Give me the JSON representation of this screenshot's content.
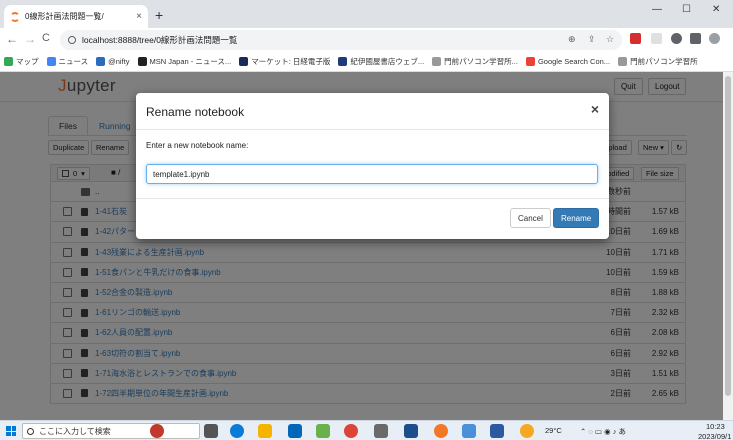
{
  "browser": {
    "tab_title": "0線形計画法問題一覧/",
    "tab_close": "×",
    "new_tab": "+",
    "window_controls": [
      "—",
      "☐",
      "✕"
    ],
    "nav": {
      "back": "←",
      "forward": "→",
      "reload": "C"
    },
    "url": "localhost:8888/tree/0線形計画法問題一覧",
    "bookmarks": [
      {
        "label": "マップ",
        "icon": "maps-icon",
        "color": "#34a853"
      },
      {
        "label": "ニュース",
        "icon": "news-icon",
        "color": "#4285f4"
      },
      {
        "label": "@nifty",
        "icon": "nifty-icon",
        "color": "#2a6ebb"
      },
      {
        "label": "MSN Japan - ニュース...",
        "icon": "msn-icon",
        "color": "#222222"
      },
      {
        "label": "マーケット: 日経電子版",
        "icon": "nikkei-icon",
        "color": "#1a2a5a"
      },
      {
        "label": "紀伊國屋書店ウェブ...",
        "icon": "kinokuniya-icon",
        "color": "#1f3b7a"
      },
      {
        "label": "門前パソコン学習所...",
        "icon": "globe-icon",
        "color": "#999999"
      },
      {
        "label": "Google Search Con...",
        "icon": "google-icon",
        "color": "#ea4335"
      },
      {
        "label": "門前パソコン学習所",
        "icon": "globe-icon",
        "color": "#999999"
      }
    ]
  },
  "jupyter": {
    "logo_text": "upyter",
    "logo_j": "J",
    "quit_label": "Quit",
    "logout_label": "Logout",
    "tabs": [
      "Files",
      "Running"
    ],
    "actions": {
      "duplicate": "Duplicate",
      "rename": "Rename",
      "upload": "Upload",
      "new": "New ▾",
      "refresh": "↻"
    },
    "list_header": {
      "select_count": "0",
      "dropdown": "▾",
      "folder": "/",
      "modified": "Modified",
      "filesize": "File size"
    },
    "files": [
      {
        "name": "..",
        "modified": "数秒前",
        "size": ""
      },
      {
        "name": "1-41石炭",
        "modified": "3時間前",
        "size": "1.57 kB"
      },
      {
        "name": "1-42パター",
        "modified": "10日前",
        "size": "1.69 kB"
      },
      {
        "name": "1-43残業による生産計画.ipynb",
        "modified": "10日前",
        "size": "1.71 kB"
      },
      {
        "name": "1-51食パンと牛乳だけの食事.ipynb",
        "modified": "10日前",
        "size": "1.59 kB"
      },
      {
        "name": "1-52合金の製造.ipynb",
        "modified": "8日前",
        "size": "1.88 kB"
      },
      {
        "name": "1-61リンゴの輸送.ipynb",
        "modified": "7日前",
        "size": "2.32 kB"
      },
      {
        "name": "1-62人員の配置.ipynb",
        "modified": "6日前",
        "size": "2.08 kB"
      },
      {
        "name": "1-63切符の割当て.ipynb",
        "modified": "6日前",
        "size": "2.92 kB"
      },
      {
        "name": "1-71海水浴とレストランでの食事.ipynb",
        "modified": "3日前",
        "size": "1.51 kB"
      },
      {
        "name": "1-72四半期単位の年間生産計画.ipynb",
        "modified": "2日前",
        "size": "2.65 kB"
      }
    ]
  },
  "modal": {
    "title": "Rename notebook",
    "close": "×",
    "prompt": "Enter a new notebook name:",
    "value": "template1.ipynb",
    "cancel_label": "Cancel",
    "rename_label": "Rename"
  },
  "taskbar": {
    "search_placeholder": "ここに入力して検索",
    "weather": "29°C",
    "time": "10:23",
    "date": "2023/09/1"
  }
}
